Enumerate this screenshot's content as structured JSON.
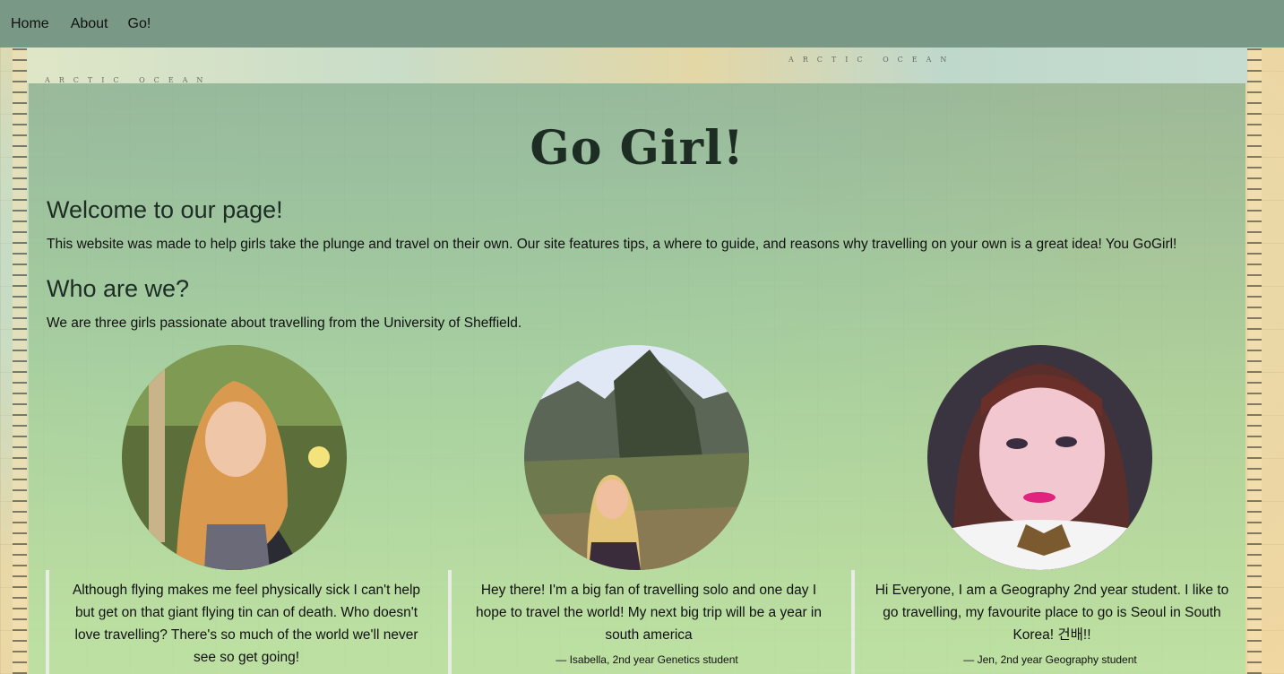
{
  "nav": {
    "items": [
      "Home",
      "About",
      "Go!"
    ]
  },
  "map": {
    "labels": [
      "ARCTIC OCEAN",
      "ARCTIC OCEAN"
    ]
  },
  "main": {
    "title": "Go Girl!",
    "welcome_heading": "Welcome to our page!",
    "welcome_text": "This website was made to help girls take the plunge and travel on their own. Our site features tips, a where to guide, and reasons why travelling on your own is a great idea! You GoGirl!",
    "who_heading": "Who are we?",
    "who_text": "We are three girls passionate about travelling from the University of Sheffield."
  },
  "profiles": [
    {
      "quote": "Although flying makes me feel physically sick I can't help but get on that giant flying tin can of death. Who doesn't love travelling? There's so much of the world we'll never see so get going!",
      "author": ""
    },
    {
      "quote": "Hey there! I'm a big fan of travelling solo and one day I hope to travel the world! My next big trip will be a year in south america",
      "author": "— Isabella, 2nd year Genetics student"
    },
    {
      "quote": "Hi Everyone, I am a Geography 2nd year student. I like to go travelling, my favourite place to go is Seoul in South Korea! 건배!!",
      "author": "— Jen, 2nd year Geography student"
    }
  ],
  "colors": {
    "navbar": "#7a9886",
    "panel_top": "#8cb294",
    "panel_bottom": "#b6e2a2",
    "heading": "#1e2d24"
  }
}
